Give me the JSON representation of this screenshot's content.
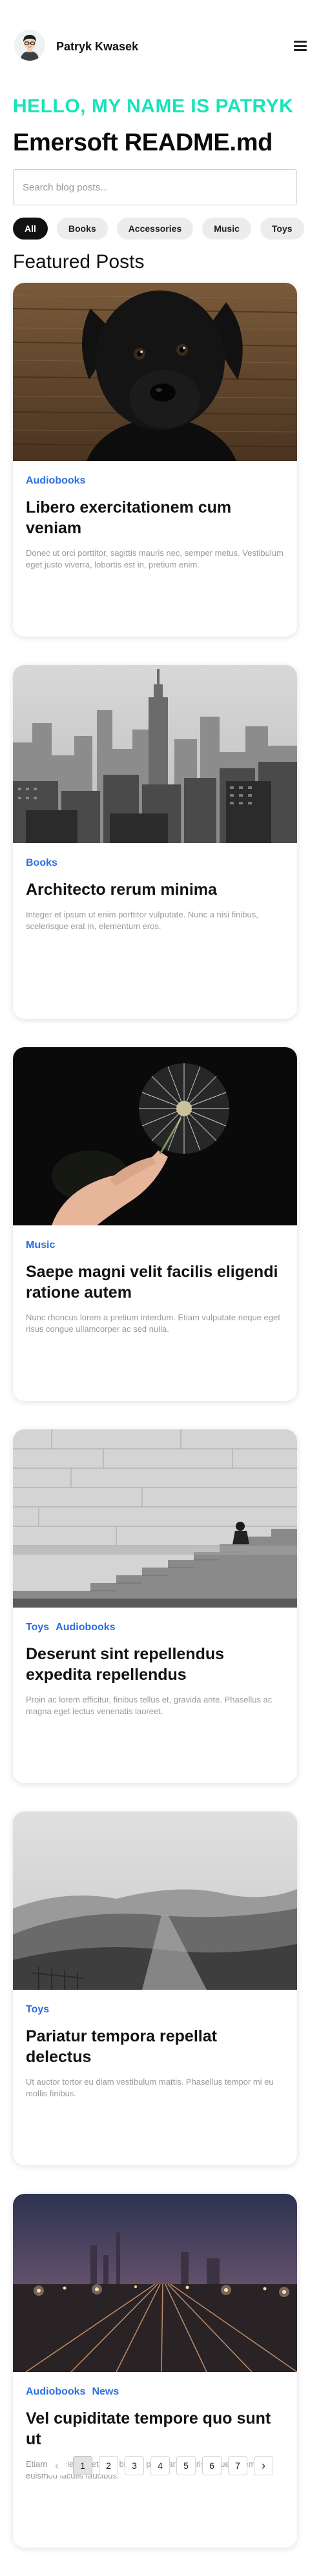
{
  "header": {
    "author_name": "Patryk Kwasek",
    "avatar_icon": "avatar-portrait",
    "menu_icon": "hamburger-menu-icon"
  },
  "hero": {
    "greeting": "HELLO, MY NAME IS PATRYK",
    "title": "Emersoft README.md"
  },
  "search": {
    "placeholder": "Search blog posts...",
    "value": ""
  },
  "filters": [
    {
      "label": "All",
      "active": true
    },
    {
      "label": "Books",
      "active": false
    },
    {
      "label": "Accessories",
      "active": false
    },
    {
      "label": "Music",
      "active": false
    },
    {
      "label": "Toys",
      "active": false
    }
  ],
  "section_title": "Featured Posts",
  "posts": [
    {
      "image": "black puppy on wooden boards",
      "tags": [
        "Audiobooks"
      ],
      "title": "Libero exercitationem cum veniam",
      "excerpt": "Donec ut orci porttitor, sagittis mauris nec, semper metus. Vestibulum eget justo viverra, lobortis est in, pretium enim."
    },
    {
      "image": "black and white city skyline",
      "tags": [
        "Books"
      ],
      "title": "Architecto rerum minima",
      "excerpt": "Integer et ipsum ut enim porttitor vulputate. Nunc a nisi finibus, scelerisque erat in, elementum eros."
    },
    {
      "image": "hand holding a dandelion",
      "tags": [
        "Music"
      ],
      "title": "Saepe magni velit facilis eligendi ratione autem",
      "excerpt": "Nunc rhoncus lorem a pretium interdum. Etiam vulputate neque eget risus congue ullamcorper ac sed nulla."
    },
    {
      "image": "person sitting on stone stairs",
      "tags": [
        "Toys",
        "Audiobooks"
      ],
      "title": "Deserunt sint repellendus expedita repellendus",
      "excerpt": "Proin ac lorem efficitur, finibus tellus et, gravida ante. Phasellus ac magna eget lectus venenatis laoreet."
    },
    {
      "image": "path over grassy hills",
      "tags": [
        "Toys"
      ],
      "title": "Pariatur tempora repellat delectus",
      "excerpt": "Ut auctor tortor eu diam vestibulum mattis. Phasellus tempor mi eu mollis finibus."
    },
    {
      "image": "railway tracks at night with city lights",
      "tags": [
        "Audiobooks",
        "News"
      ],
      "title": "Vel cupiditate tempore quo sunt ut",
      "excerpt": "Etiam ultricies ex et sem blandit pulvinar. Mauris aliquet lorem euismod iaculis faucibus."
    }
  ],
  "pagination": {
    "prev_icon": "chevron-left-icon",
    "next_icon": "chevron-right-icon",
    "prev": "‹",
    "next": "›",
    "pages": [
      "1",
      "2",
      "3",
      "4",
      "5",
      "6",
      "7"
    ],
    "current": "1"
  },
  "colors": {
    "accent": "#17e4b8",
    "tag": "#2d6fe0",
    "chip_active": "#111111",
    "chip": "#ececec"
  }
}
